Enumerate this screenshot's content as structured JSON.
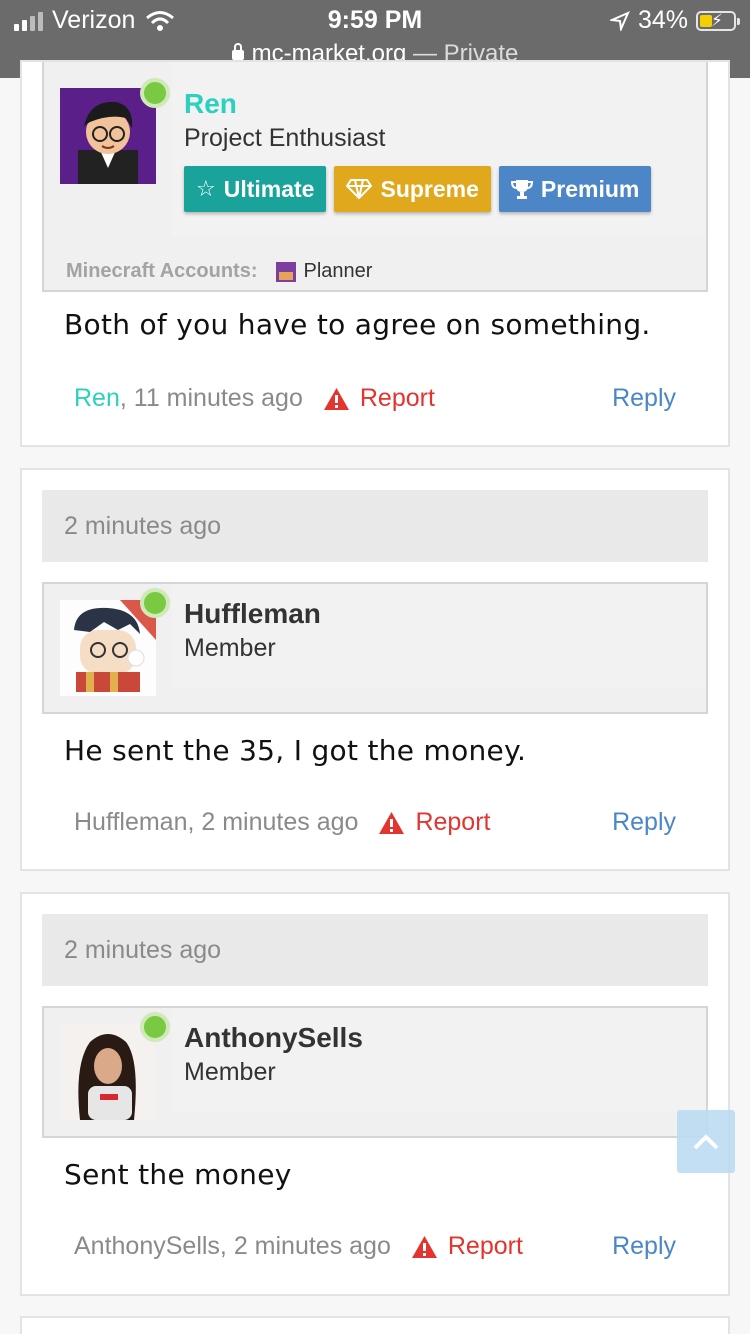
{
  "status_bar": {
    "carrier": "Verizon",
    "time": "9:59 PM",
    "battery": "34%",
    "url": "mc-market.org",
    "url_separator": " — ",
    "privacy": "Private"
  },
  "colors": {
    "ultimate": "#1aa39b",
    "supreme": "#e0a81c",
    "premium": "#4d86c7",
    "accent_username": "#2cd0bf",
    "report": "#e3342f",
    "reply": "#4a87c6"
  },
  "posts": [
    {
      "username": "Ren",
      "user_title": "Project Enthusiast",
      "badges": [
        {
          "label": "Ultimate",
          "icon": "star-outline-icon"
        },
        {
          "label": "Supreme",
          "icon": "diamond-icon"
        },
        {
          "label": "Premium",
          "icon": "trophy-icon"
        }
      ],
      "mc_accounts_label": "Minecraft Accounts:",
      "mc_account": "Planner",
      "message": "Both of you have to agree on something.",
      "meta_author": "Ren",
      "meta_time": ", 11 minutes ago",
      "report_label": "Report",
      "reply_label": "Reply"
    },
    {
      "date": "2 minutes ago",
      "username": "Huffleman",
      "user_title": "Member",
      "message": "He sent the 35, I got the money.",
      "meta": "Huffleman, 2 minutes ago",
      "report_label": "Report",
      "reply_label": "Reply"
    },
    {
      "date": "2 minutes ago",
      "username": "AnthonySells",
      "user_title": "Member",
      "message": "Sent the money",
      "meta": "AnthonySells, 2 minutes ago",
      "report_label": "Report",
      "reply_label": "Reply"
    }
  ]
}
